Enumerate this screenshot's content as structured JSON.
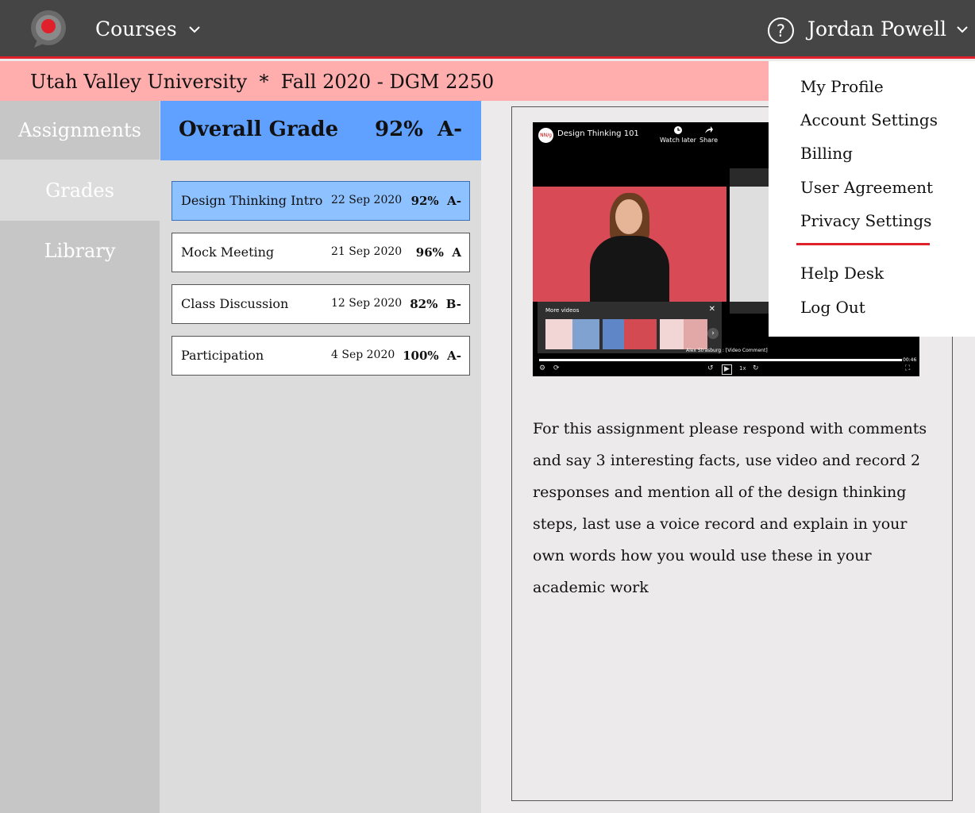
{
  "topbar": {
    "courses_label": "Courses",
    "help_symbol": "?",
    "user_name": "Jordan Powell",
    "accent_color": "#E0202A"
  },
  "subheader": {
    "text": "Utah Valley University  *  Fall 2020 - DGM 2250"
  },
  "sidebar": {
    "items": [
      {
        "label": "Assignments"
      },
      {
        "label": "Grades"
      },
      {
        "label": "Library"
      }
    ]
  },
  "overall": {
    "label": "Overall Grade",
    "value": "92%  A-"
  },
  "grades": [
    {
      "title": "Design Thinking Intro",
      "date": "22 Sep 2020",
      "score": "92%  A-"
    },
    {
      "title": "Mock Meeting",
      "date": "21 Sep 2020",
      "score": "96%  A"
    },
    {
      "title": "Class Discussion",
      "date": "12 Sep 2020",
      "score": "82%  B-"
    },
    {
      "title": "Participation",
      "date": "4 Sep 2020",
      "score": "100%  A-"
    }
  ],
  "video": {
    "title": "Design Thinking 101",
    "badge": "NN/g",
    "watch_later": "Watch later",
    "share": "Share",
    "more_videos": "More videos",
    "author": "Alex Strasburg : [Video Comment]",
    "time": "00:46",
    "speed": "1x"
  },
  "instructions": "For this assignment please respond with comments and say 3 interesting facts, use video and record 2 responses and mention all of the design thinking steps, last use a voice record and explain in your own words how you would use these in your academic work",
  "dropdown": {
    "items_top": [
      "My Profile",
      "Account Settings",
      "Billing",
      "User Agreement",
      "Privacy Settings"
    ],
    "items_bottom": [
      "Help Desk",
      "Log Out"
    ]
  }
}
